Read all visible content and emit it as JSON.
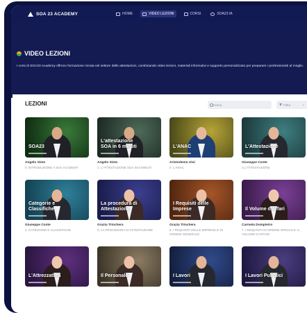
{
  "app": {
    "name": "SOA 23 ACADEMY"
  },
  "nav": [
    {
      "label": "HOME",
      "icon": "home-icon",
      "active": false
    },
    {
      "label": "VIDEO LEZIONI",
      "icon": "video-icon",
      "active": true
    },
    {
      "label": "CORSI",
      "icon": "monitor-icon",
      "active": false
    },
    {
      "label": "SOA23 IA",
      "icon": "globe-icon",
      "active": false
    }
  ],
  "hero": {
    "title": "VIDEO LEZIONI",
    "description": "I corsi di SOA23 Academy offrono formazione mirata nel settore delle attestazioni, combinando video lezioni, materiali informativi e supporto personalizzato per preparare i professionisti al meglio."
  },
  "lessons_section": {
    "title": "LEZIONI",
    "search_placeholder": "Cerca",
    "filter_label": "Filtra"
  },
  "lessons": [
    {
      "thumb_title": "SOA23",
      "author": "Angelo Sisto",
      "lesson": "0. INTRODUZIONE A SOA ACADEMY",
      "bg": "#3a7a3a",
      "bg2": "#0f2d12",
      "skin": "#d9a987",
      "outfit": "#1f2126"
    },
    {
      "thumb_title": "L'attestazione SOA in 6 minuti",
      "author": "Angelo Sisto",
      "lesson": "1. L'ATTESTAZIONE SOA IN 6 MINUTI",
      "bg": "#4e6a58",
      "bg2": "#1d2a24",
      "skin": "#d9a987",
      "outfit": "#1f2126"
    },
    {
      "thumb_title": "L'ANAC",
      "author": "Aristodemo Aloi",
      "lesson": "2. L'ANAC",
      "bg": "#b7a437",
      "bg2": "#4a4a1a",
      "skin": "#e6b99c",
      "outfit": "#1e3f74"
    },
    {
      "thumb_title": "L'Attestazione",
      "author": "Giuseppe Conte",
      "lesson": "3.L'ATTESTAZIONE",
      "bg": "#3e7e80",
      "bg2": "#1c3a3c",
      "skin": "#e4b596",
      "outfit": "#262830"
    },
    {
      "thumb_title": "Categorie e Classifiche",
      "author": "Giuseppe Conte",
      "lesson": "4. CATEGORIE E CLASSIFICHE",
      "bg": "#2f7f98",
      "bg2": "#134253",
      "skin": "#e4b596",
      "outfit": "#262830"
    },
    {
      "thumb_title": "La procedura di Attestazione",
      "author": "Grazia Trinchera",
      "lesson": "5. LA PROCEDURA DI ATTESTAZIONE",
      "bg": "#3b3f8f",
      "bg2": "#191c4a",
      "skin": "#edc1a6",
      "outfit": "#3b2a25"
    },
    {
      "thumb_title": "I Requisiti delle Imprese",
      "author": "Grazia Trinchera",
      "lesson": "6. I REQUISITI DELLE IMPRESE E DI ORDINE GENERALE",
      "bg": "#a55528",
      "bg2": "#51260f",
      "skin": "#edc1a6",
      "outfit": "#3b2a25"
    },
    {
      "thumb_title": "Il Volume d'Affari",
      "author": "Carmela Dompietro",
      "lesson": "7. I REQUISITI DI ORDINE SPECIALE: IL VOLUME D'AFFARI",
      "bg": "#7a3f96",
      "bg2": "#3a1b4a",
      "skin": "#efc7ad",
      "outfit": "#2a1d1c"
    },
    {
      "thumb_title": "L'Attrezzatura",
      "author": "",
      "lesson": "",
      "bg": "#5e2f7d",
      "bg2": "#2a1540",
      "skin": "#efc7ad",
      "outfit": "#2a1d1c"
    },
    {
      "thumb_title": "Il Personale",
      "author": "",
      "lesson": "",
      "bg": "#8b7c63",
      "bg2": "#3b3427",
      "skin": "#edc1a6",
      "outfit": "#3b2a25"
    },
    {
      "thumb_title": "I Lavori",
      "author": "",
      "lesson": "",
      "bg": "#304a8a",
      "bg2": "#141f3f",
      "skin": "#e4b596",
      "outfit": "#262830"
    },
    {
      "thumb_title": "I Lavori Pubblici",
      "author": "",
      "lesson": "",
      "bg": "#4b3d80",
      "bg2": "#1e1840",
      "skin": "#e4b596",
      "outfit": "#262830"
    }
  ]
}
